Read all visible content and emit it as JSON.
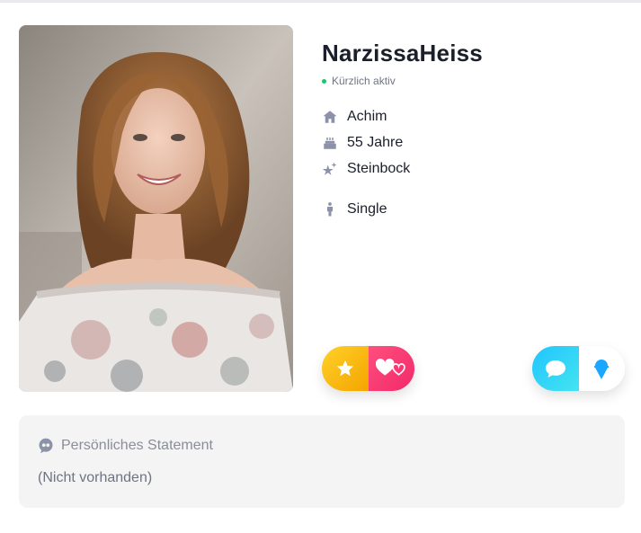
{
  "profile": {
    "username": "NarzissaHeiss",
    "status": "Kürzlich aktiv",
    "details": {
      "city": "Achim",
      "age": "55 Jahre",
      "zodiac": "Steinbock",
      "relationship": "Single"
    }
  },
  "statement": {
    "title": "Persönliches Statement",
    "text": "(Nicht vorhanden)"
  },
  "icons": {
    "city": "home-icon",
    "age": "birthday-cake-icon",
    "zodiac": "sparkle-star-icon",
    "relationship": "person-icon",
    "favorite": "star-icon",
    "like": "hearts-icon",
    "chat": "chat-bubble-icon",
    "icebreaker": "ice-cream-icon",
    "statement": "speech-bubble-icon"
  },
  "colors": {
    "online": "#1ec46b",
    "favorite_gradient": [
      "#ffd12a",
      "#f5a400"
    ],
    "like_gradient": [
      "#ff4f7d",
      "#f2296b"
    ],
    "chat_gradient": [
      "#22c4ff",
      "#43e4f0"
    ],
    "icon_gray": "#8c93a8",
    "icebreaker_blue": "#1aa7ff"
  }
}
